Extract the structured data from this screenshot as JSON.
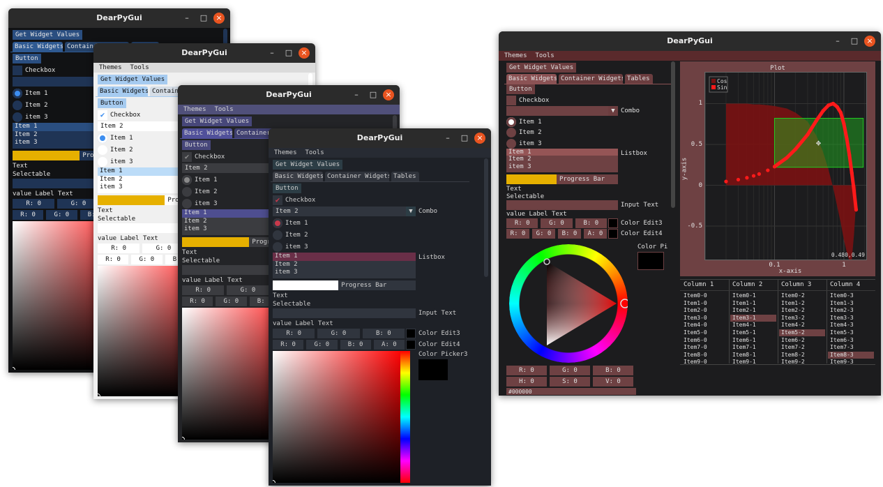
{
  "widgets": {
    "get_values": "Get Widget Values",
    "tabs": [
      "Basic Widgets",
      "Container Widgets",
      "Tables"
    ],
    "button": "Button",
    "checkbox": "Checkbox",
    "combo_label": "Combo",
    "radio": [
      "Item 1",
      "Item 2",
      "item 3"
    ],
    "listbox_items": [
      "Item 1",
      "Item 2",
      "item 3"
    ],
    "listbox_label": "Listbox",
    "progress_label": "Progress Bar",
    "text": "Text",
    "selectable": "Selectable",
    "input_label": "Input Text",
    "value_label": "value Label Text",
    "edit3_fields": [
      "R:  0",
      "G:  0",
      "B:  0"
    ],
    "edit3_label": "Color Edit3",
    "edit4_fields": [
      "R:  0",
      "G:  0",
      "B:  0",
      "A:  0"
    ],
    "edit4_label": "Color Edit4",
    "picker_label": "Color Picker3",
    "picker_rgb": [
      "R:  0",
      "G:  0",
      "B:  0"
    ],
    "picker_hsv": [
      "H:  0",
      "S:  0",
      "V:  0"
    ],
    "picker_hex": "#000000"
  },
  "windows": [
    {
      "title": "DearPyGui",
      "menu": [],
      "checked": false,
      "combo_value": "",
      "radio_selected": 0,
      "list_selected": 0,
      "progress": 0.47,
      "theme": {
        "bg": "#111214",
        "menubar": "#111214",
        "button": "#2a4e80",
        "tab_active": "#2f5a92",
        "tab": "#24426a",
        "frame": "#1f3455",
        "text": "#e8e8e8",
        "accent": "#3d8ef0",
        "list_sel": "#2a4e80",
        "progress": "#e6b000"
      }
    },
    {
      "title": "DearPyGui",
      "menu": [
        "Themes",
        "Tools"
      ],
      "checked": true,
      "combo_value": "Item 2",
      "radio_selected": 0,
      "list_selected": 0,
      "progress": 0.47,
      "theme": {
        "bg": "#f0f0f0",
        "menubar": "#dbdbdb",
        "button": "#a6cbf0",
        "tab_active": "#a6cbf0",
        "tab": "#d5dde6",
        "frame": "#ffffff",
        "text": "#111111",
        "accent": "#3d8ef0",
        "list_sel": "#bcdcf8",
        "progress": "#e6b000"
      }
    },
    {
      "title": "DearPyGui",
      "menu": [
        "Themes",
        "Tools"
      ],
      "checked": true,
      "combo_value": "Item 2",
      "radio_selected": 0,
      "list_selected": 0,
      "progress": 0.47,
      "theme": {
        "bg": "#232427",
        "menubar": "#50507a",
        "button": "#47477a",
        "tab_active": "#50509a",
        "tab": "#3f3f70",
        "frame": "#3b3c40",
        "text": "#d8d8d8",
        "accent": "#8a8a8a",
        "list_sel": "#4e4e90",
        "progress": "#e6b000"
      }
    },
    {
      "title": "DearPyGui",
      "menu": [
        "Themes",
        "Tools"
      ],
      "checked": true,
      "combo_value": "Item 2",
      "radio_selected": 0,
      "list_selected": 0,
      "progress": 0.46,
      "theme": {
        "bg": "#1e2127",
        "menubar": "#272b33",
        "button": "#2c3d45",
        "tab_active": "#3a3d45",
        "tab": "#30343c",
        "frame": "#30353e",
        "text": "#cfcfcf",
        "accent": "#c8394b",
        "list_sel": "#6a2f48",
        "progress": "#ffffff"
      }
    },
    {
      "title": "DearPyGui",
      "menu": [
        "Themes",
        "Tools"
      ],
      "checked": false,
      "combo_value": "",
      "radio_selected": 0,
      "list_selected": 0,
      "progress": 0.45,
      "theme": {
        "bg": "#1c1c1e",
        "menubar": "#5a2a2c",
        "button": "#6b3d3f",
        "tab_active": "#8b5254",
        "tab": "#6b3d3f",
        "frame": "#6e4143",
        "text": "#e0e0e0",
        "accent": "#ffffff",
        "list_sel": "#955556",
        "progress": "#e6b000"
      }
    }
  ],
  "plot": {
    "title": "Plot",
    "xlabel": "x-axis",
    "ylabel": "y-axis",
    "xscale": "log",
    "xlim": [
      0.01,
      2.1
    ],
    "ylim": [
      -0.91,
      1.38
    ],
    "xticks": [
      {
        "v": 0.1,
        "label": "0.1"
      },
      {
        "v": 1,
        "label": "1"
      }
    ],
    "yticks": [
      {
        "v": 1,
        "label": "1"
      },
      {
        "v": 0.5,
        "label": "0.5"
      },
      {
        "v": 0,
        "label": "0"
      },
      {
        "v": -0.5,
        "label": "-0.5"
      }
    ],
    "legend": [
      "Cos",
      "Sin"
    ],
    "colors": {
      "cos": "#7a1212",
      "sin": "#ff1a1a",
      "drag_rect": "#22bb22",
      "panel": "#6e4143"
    },
    "series": {
      "x": [
        0.02,
        0.03,
        0.04,
        0.05,
        0.06,
        0.08,
        0.1,
        0.15,
        0.2,
        0.3,
        0.4,
        0.5,
        0.6,
        0.7,
        0.8,
        0.9,
        1.0,
        1.1,
        1.2,
        1.3,
        1.4,
        1.5
      ],
      "sin": [
        0.046,
        0.069,
        0.092,
        0.115,
        0.138,
        0.183,
        0.228,
        0.336,
        0.44,
        0.62,
        0.79,
        0.91,
        0.98,
        1.0,
        0.96,
        0.89,
        0.75,
        0.57,
        0.37,
        0.15,
        -0.07,
        -0.3
      ],
      "cos": [
        1.0,
        1.0,
        1.0,
        0.99,
        0.99,
        0.98,
        0.97,
        0.94,
        0.89,
        0.78,
        0.61,
        0.41,
        0.19,
        -0.03,
        -0.26,
        -0.46,
        -0.67,
        -0.82,
        -0.93,
        -0.91,
        -0.6,
        -0.2
      ]
    },
    "drag_rect": {
      "x": [
        0.1,
        1.9
      ],
      "y": [
        0.22,
        0.82
      ]
    },
    "drag_point": {
      "x": 0.43,
      "y": 0.52
    },
    "mouse_readout": "0.480,0.49"
  },
  "table": {
    "columns": [
      "Column 1",
      "Column 2",
      "Column 3",
      "Column 4"
    ],
    "rows": [
      [
        "Item0-0",
        "Item0-1",
        "Item0-2",
        "Item0-3"
      ],
      [
        "Item1-0",
        "Item1-1",
        "Item1-2",
        "Item1-3"
      ],
      [
        "Item2-0",
        "Item2-1",
        "Item2-2",
        "Item2-3"
      ],
      [
        "Item3-0",
        "Item3-1",
        "Item3-2",
        "Item3-3"
      ],
      [
        "Item4-0",
        "Item4-1",
        "Item4-2",
        "Item4-3"
      ],
      [
        "Item5-0",
        "Item5-1",
        "Item5-2",
        "Item5-3"
      ],
      [
        "Item6-0",
        "Item6-1",
        "Item6-2",
        "Item6-3"
      ],
      [
        "Item7-0",
        "Item7-1",
        "Item7-2",
        "Item7-3"
      ],
      [
        "Item8-0",
        "Item8-1",
        "Item8-2",
        "Item8-3"
      ],
      [
        "Item9-0",
        "Item9-1",
        "Item9-2",
        "Item9-3"
      ]
    ],
    "selected": [
      [
        3,
        1
      ],
      [
        5,
        2
      ],
      [
        8,
        3
      ]
    ]
  }
}
